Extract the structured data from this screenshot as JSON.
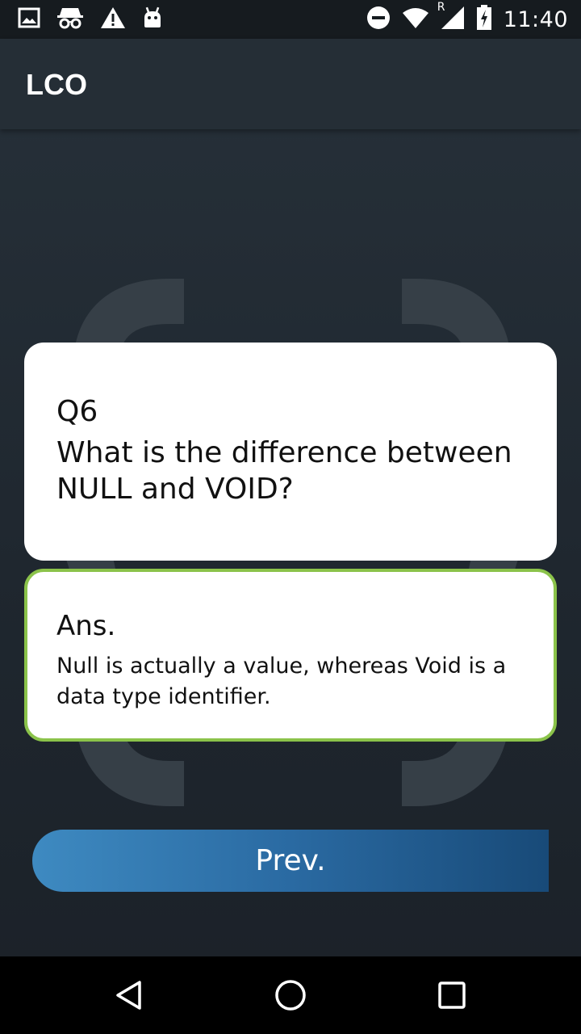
{
  "status_bar": {
    "time": "11:40",
    "network_badge": "R",
    "left_icons": [
      "gallery-icon",
      "incognito-icon",
      "warning-icon",
      "android-icon"
    ],
    "right_icons": [
      "do-not-disturb-icon",
      "wifi-icon",
      "cell-signal-icon",
      "battery-charging-icon"
    ]
  },
  "app_bar": {
    "title": "LCO"
  },
  "question": {
    "number": "Q6",
    "text": "What is the difference between NULL and VOID?"
  },
  "answer": {
    "label": "Ans.",
    "text": "Null is actually a value, whereas Void is a data type identifier."
  },
  "prev_button": {
    "label": "Prev."
  },
  "nav_bar": {
    "icons": [
      "back-icon",
      "home-icon",
      "recents-icon"
    ]
  },
  "colors": {
    "answer_border": "#8bc34a",
    "button_start": "#3e8ac1",
    "button_end": "#184a78",
    "app_bar": "#252e36",
    "status_bar": "#161b1f"
  }
}
